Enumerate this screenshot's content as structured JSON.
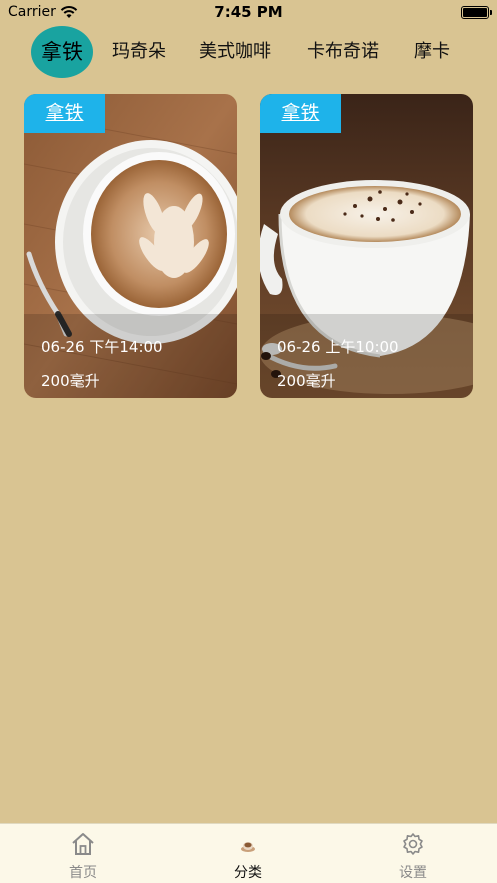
{
  "status_bar": {
    "carrier": "Carrier",
    "time": "7:45 PM"
  },
  "categories": [
    "拿铁",
    "玛奇朵",
    "美式咖啡",
    "卡布奇诺",
    "摩卡"
  ],
  "selected_category": "拿铁",
  "cards": [
    {
      "tag": "拿铁",
      "time": "06-26 下午14:00",
      "volume": "200毫升",
      "image": "latte-art-cup-photo"
    },
    {
      "tag": "拿铁",
      "time": "06-26 上午10:00",
      "volume": "200毫升",
      "image": "cocoa-dusted-cup-photo"
    }
  ],
  "tabbar": [
    {
      "label": "首页",
      "icon": "home-icon"
    },
    {
      "label": "分类",
      "icon": "coffee-cup-icon"
    },
    {
      "label": "设置",
      "icon": "gear-icon"
    }
  ],
  "tabbar_selected": "分类",
  "colors": {
    "background": "#d9c492",
    "active_tab": "#19a3a0",
    "tag": "#1eb3ea",
    "tabbar": "#fcf8e8"
  }
}
